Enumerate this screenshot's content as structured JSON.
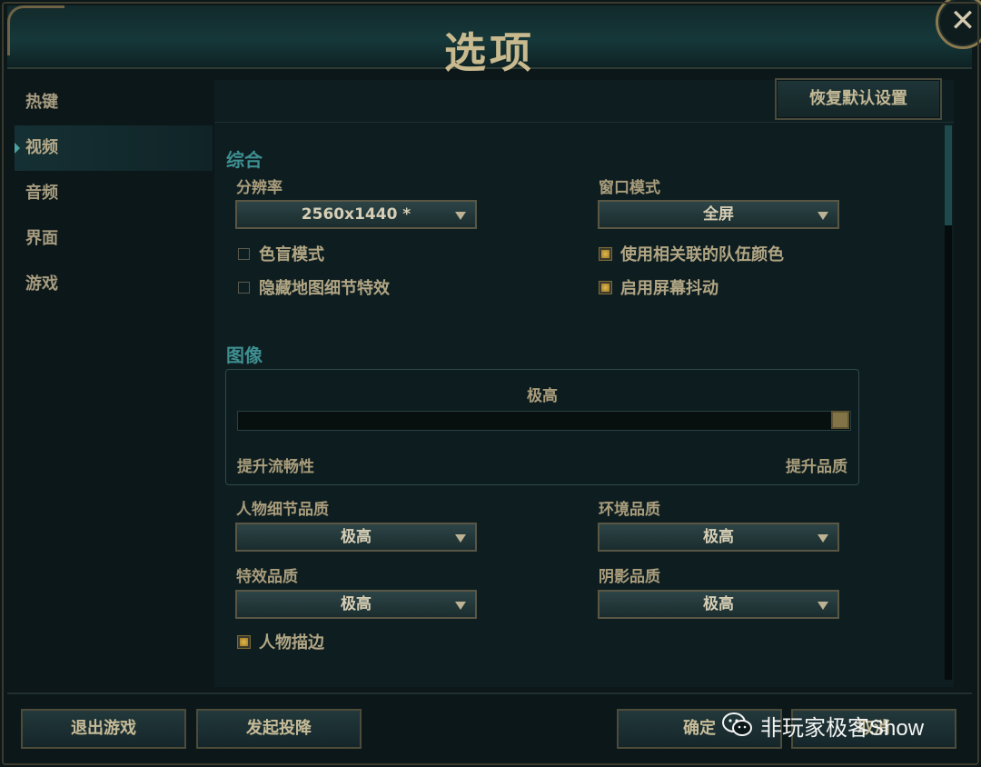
{
  "window": {
    "title": "选项",
    "close_glyph": "✕"
  },
  "sidebar": {
    "items": [
      {
        "label": "热键",
        "active": false
      },
      {
        "label": "视频",
        "active": true
      },
      {
        "label": "音频",
        "active": false
      },
      {
        "label": "界面",
        "active": false
      },
      {
        "label": "游戏",
        "active": false
      }
    ]
  },
  "content": {
    "reset_label": "恢复默认设置",
    "general": {
      "title": "综合",
      "resolution": {
        "label": "分辨率",
        "value": "2560x1440 *"
      },
      "window_mode": {
        "label": "窗口模式",
        "value": "全屏"
      },
      "checks_left": [
        {
          "label": "色盲模式",
          "checked": false
        },
        {
          "label": "隐藏地图细节特效",
          "checked": false
        }
      ],
      "checks_right": [
        {
          "label": "使用相关联的队伍颜色",
          "checked": true
        },
        {
          "label": "启用屏幕抖动",
          "checked": true
        }
      ]
    },
    "graphics": {
      "title": "图像",
      "quality_label": "极高",
      "quality_level": 1.0,
      "slider_left": "提升流畅性",
      "slider_right": "提升品质",
      "character_quality": {
        "label": "人物细节品质",
        "value": "极高"
      },
      "environment_quality": {
        "label": "环境品质",
        "value": "极高"
      },
      "effects_quality": {
        "label": "特效品质",
        "value": "极高"
      },
      "shadow_quality": {
        "label": "阴影品质",
        "value": "极高"
      },
      "outline": {
        "label": "人物描边",
        "checked": true
      }
    }
  },
  "footer": {
    "exit_label": "退出游戏",
    "surrender_label": "发起投降",
    "ok_label": "确定",
    "cancel_label": "取消"
  },
  "watermark": {
    "text": "非玩家极客Show",
    "icon": "wechat-icon"
  },
  "colors": {
    "accent_teal": "#3e8f91",
    "gold": "#c8b98e",
    "checkbox_on": "#e1b94d"
  }
}
